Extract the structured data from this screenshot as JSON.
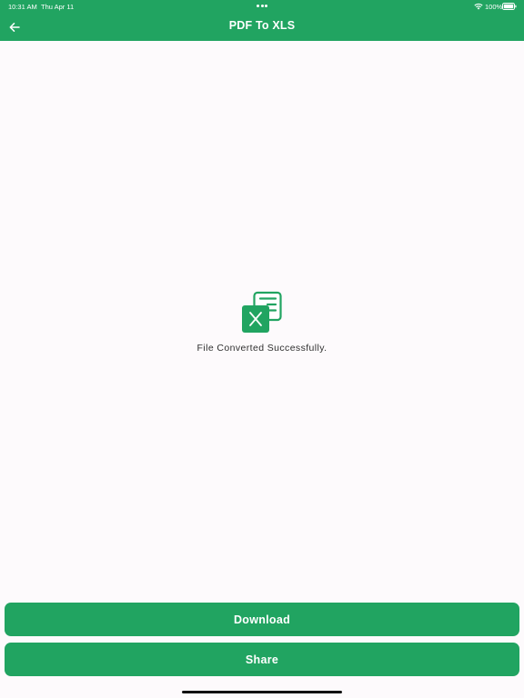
{
  "status_bar": {
    "time": "10:31 AM",
    "date": "Thu Apr 11",
    "battery": "100%",
    "wifi_icon": "wifi-icon",
    "battery_icon": "battery-icon"
  },
  "header": {
    "title": "PDF To XLS",
    "back_icon": "arrow-left-icon",
    "background_color": "#21a461"
  },
  "main": {
    "icon": "xls-file-icon",
    "message": "File Converted Successfully."
  },
  "actions": {
    "download_label": "Download",
    "share_label": "Share",
    "button_color": "#21a461"
  }
}
